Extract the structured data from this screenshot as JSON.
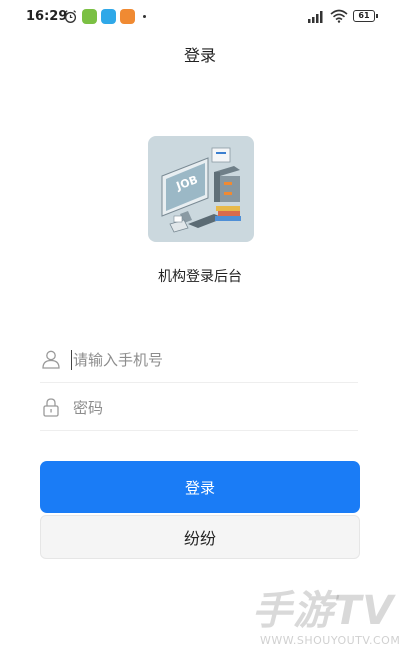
{
  "status_bar": {
    "time": "16:29",
    "battery": "61",
    "icons": [
      "alarm-icon",
      "app-icon",
      "app-icon",
      "app-icon",
      "signal-icon",
      "wifi-icon",
      "battery-icon"
    ]
  },
  "page": {
    "title": "登录"
  },
  "illustration": {
    "job_label": "JOB"
  },
  "org": {
    "caption": "机构登录后台"
  },
  "form": {
    "phone_placeholder": "请输入手机号",
    "phone_value": "",
    "password_placeholder": "密码",
    "password_value": ""
  },
  "buttons": {
    "login_label": "登录",
    "secondary_label": "纷纷"
  },
  "watermark": {
    "main": "手游TV",
    "sub": "WWW.SHOUYOUTV.COM"
  },
  "colors": {
    "accent": "#1a7cf6",
    "illustration_bg": "#cbd8de"
  }
}
